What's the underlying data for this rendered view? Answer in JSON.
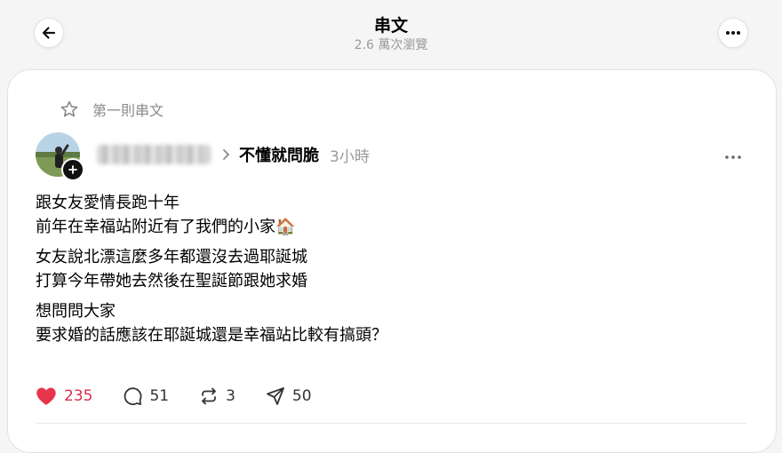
{
  "header": {
    "title": "串文",
    "views": "2.6 萬次瀏覽"
  },
  "post": {
    "pin_label": "第一則串文",
    "topic": "不懂就問脆",
    "time": "3小時",
    "paragraphs": [
      "跟女友愛情長跑十年\n前年在幸福站附近有了我們的小家🏠",
      "女友說北漂這麼多年都還沒去過耶誕城\n打算今年帶她去然後在聖誕節跟她求婚",
      "想問問大家\n要求婚的話應該在耶誕城還是幸福站比較有搞頭？"
    ],
    "stats": {
      "likes": "235",
      "replies": "51",
      "reposts": "3",
      "shares": "50"
    }
  },
  "colors": {
    "like": "#d92f4a",
    "muted": "#999999",
    "background": "#f5f5f5"
  },
  "icons": [
    "back-arrow-icon",
    "more-icon",
    "star-icon",
    "plus-icon",
    "chevron-right-icon",
    "heart-icon",
    "comment-icon",
    "repost-icon",
    "send-icon"
  ]
}
